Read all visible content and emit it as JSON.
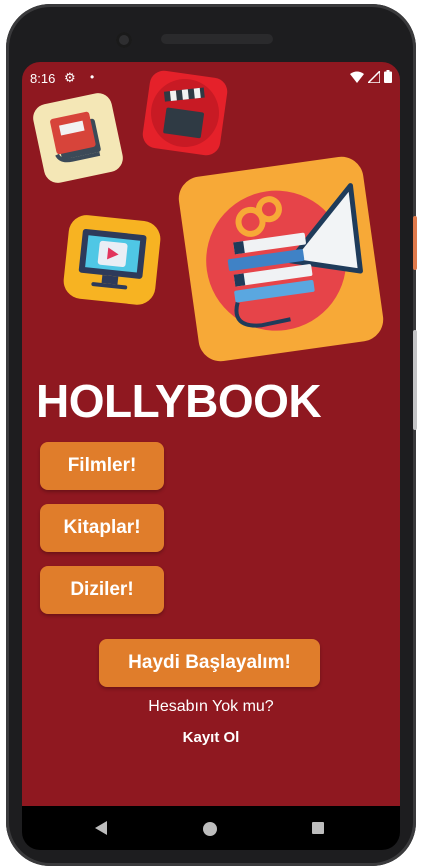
{
  "status_bar": {
    "time": "8:16",
    "icons": [
      "gear-icon",
      "dot-icon",
      "wifi-icon",
      "signal-icon",
      "battery-icon"
    ]
  },
  "decor_icons": [
    "book-icon",
    "clapperboard-icon",
    "tv-icon",
    "cinema-books-icon"
  ],
  "app": {
    "title": "HOLLYBOOK",
    "categories": [
      "Filmler!",
      "Kitaplar!",
      "Diziler!"
    ],
    "start_button": "Haydi Başlayalım!",
    "no_account_text": "Hesabın Yok mu?",
    "register_link": "Kayıt Ol"
  },
  "colors": {
    "background": "#8f1820",
    "button": "#e07d2b",
    "text": "#ffffff"
  },
  "nav_bar": {
    "buttons": [
      "back-icon",
      "home-icon",
      "recents-icon"
    ]
  }
}
